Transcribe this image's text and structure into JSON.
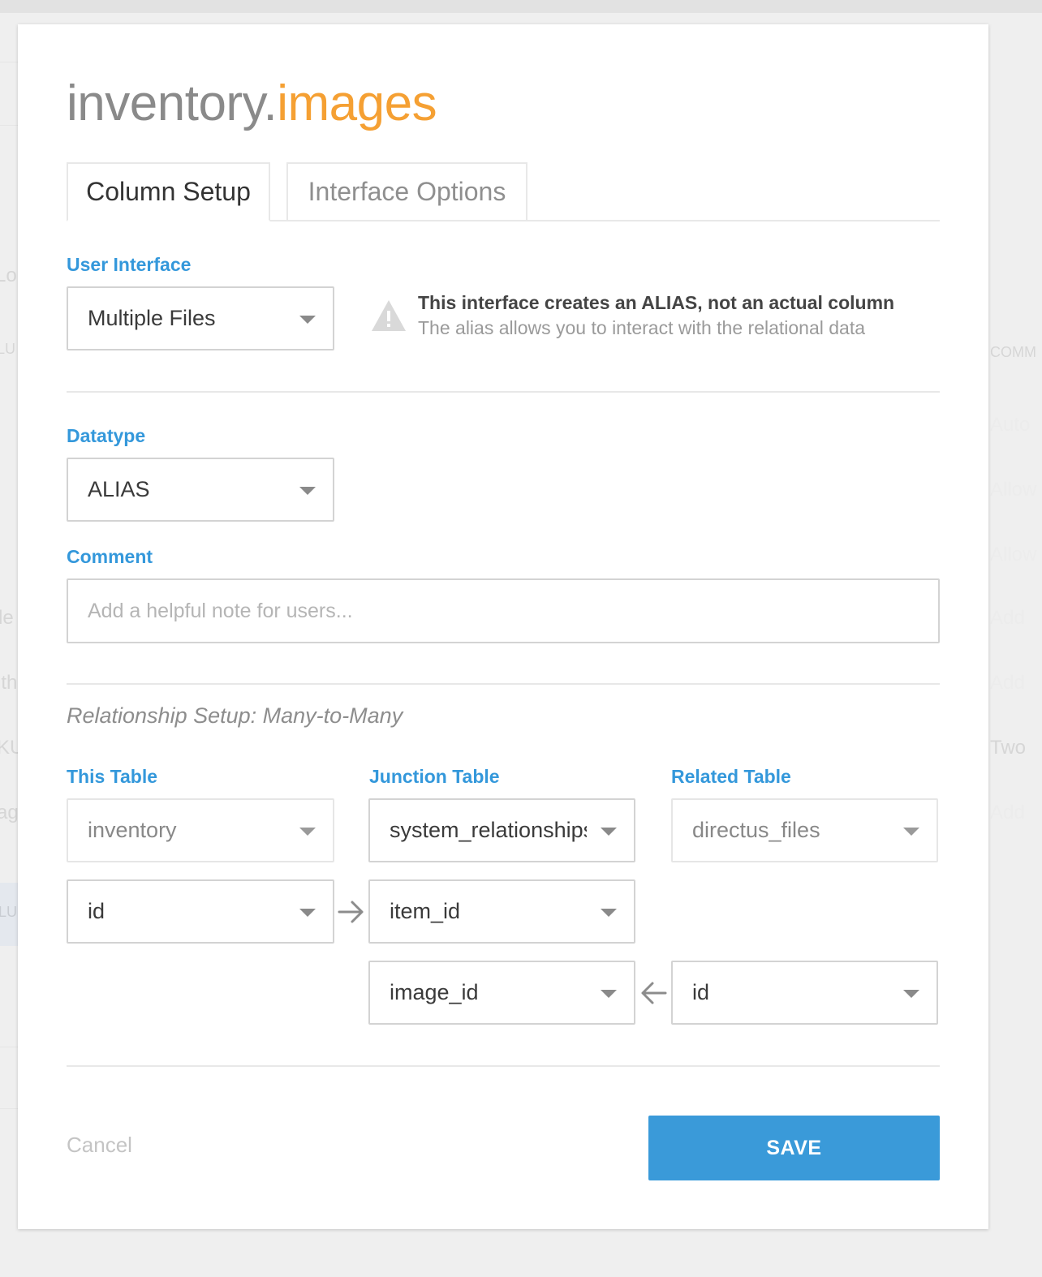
{
  "header": {
    "title_prefix": "inventory.",
    "title_table": "images"
  },
  "tabs": [
    {
      "label": "Column Setup",
      "active": true
    },
    {
      "label": "Interface Options",
      "active": false
    }
  ],
  "user_interface": {
    "label": "User Interface",
    "value": "Multiple Files"
  },
  "alias_notice": {
    "icon": "warning-icon",
    "title": "This interface creates an ALIAS, not an actual column",
    "subtitle": "The alias allows you to interact with the relational data"
  },
  "datatype": {
    "label": "Datatype",
    "value": "ALIAS"
  },
  "comment": {
    "label": "Comment",
    "value": "",
    "placeholder": "Add a helpful note for users..."
  },
  "relationship": {
    "section_title": "Relationship Setup: Many-to-Many",
    "this_table": {
      "label": "This Table",
      "table": "inventory",
      "column": "id"
    },
    "junction_table": {
      "label": "Junction Table",
      "table": "system_relationships",
      "this_key": "item_id",
      "related_key": "image_id"
    },
    "related_table": {
      "label": "Related Table",
      "table": "directus_files",
      "column": "id"
    }
  },
  "footer": {
    "cancel_label": "Cancel",
    "save_label": "SAVE"
  },
  "colors": {
    "accent": "#3a9ad9",
    "title_highlight": "#f5a033",
    "label": "#3498db"
  },
  "background_fragments": [
    "Lo",
    "LU",
    "COMM",
    "Auto",
    "Allow",
    "Allow",
    "le",
    "Add",
    "ith",
    "Add",
    "KU",
    "Two",
    "ag",
    "Add",
    "LU"
  ]
}
